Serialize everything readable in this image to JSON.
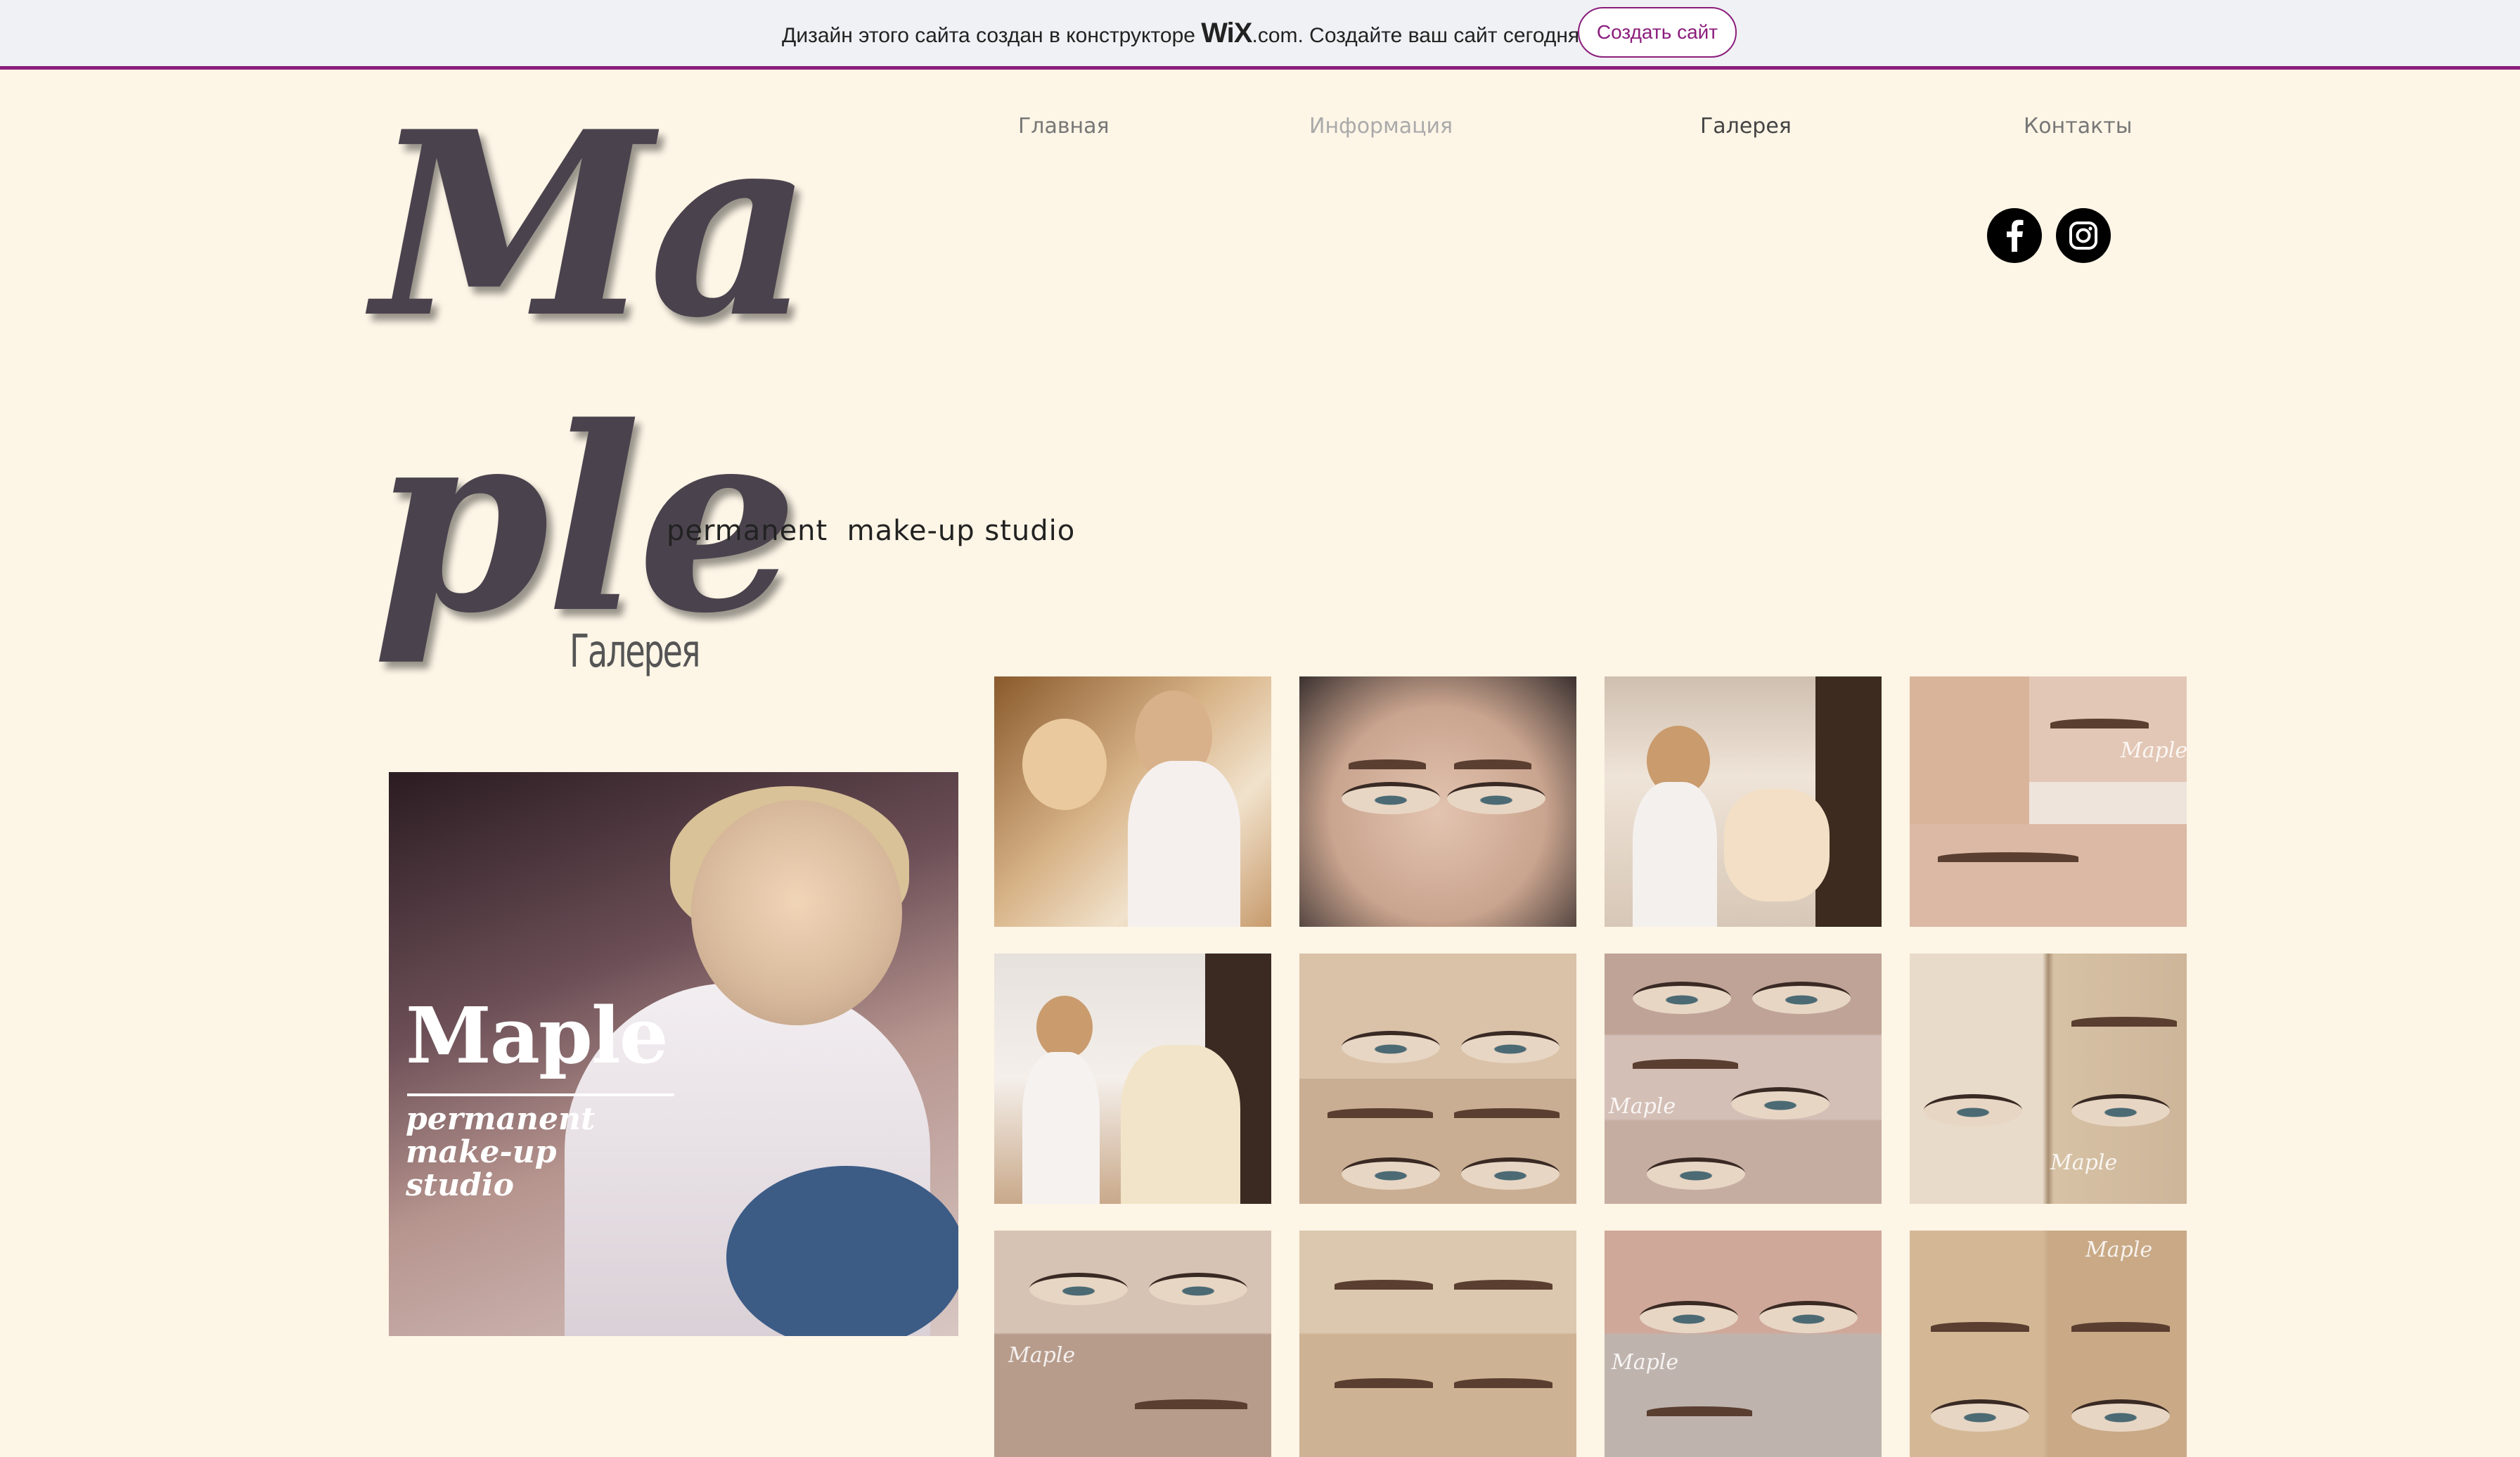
{
  "banner": {
    "text_before": "Дизайн этого сайта создан в конструкторе ",
    "wix_logo": "WiX",
    "text_after": ".com. Создайте ваш сайт сегодня.",
    "cta": "Создать сайт"
  },
  "logo": {
    "title": "Maple",
    "subtitle": "permanent  make-up studio"
  },
  "nav": [
    {
      "label": "Главная"
    },
    {
      "label": "Информация"
    },
    {
      "label": "Галерея"
    },
    {
      "label": "Контакты"
    }
  ],
  "social": [
    {
      "icon": "facebook-icon"
    },
    {
      "icon": "instagram-icon"
    }
  ],
  "gallery": {
    "title": "Галерея",
    "hero": {
      "title": "Maple",
      "subtitle": "permanent make-up studio"
    },
    "watermark": "Maple"
  },
  "colors": {
    "background": "#fdf5e6",
    "banner_accent": "#8b1d7c",
    "logo": "#4a434d"
  }
}
